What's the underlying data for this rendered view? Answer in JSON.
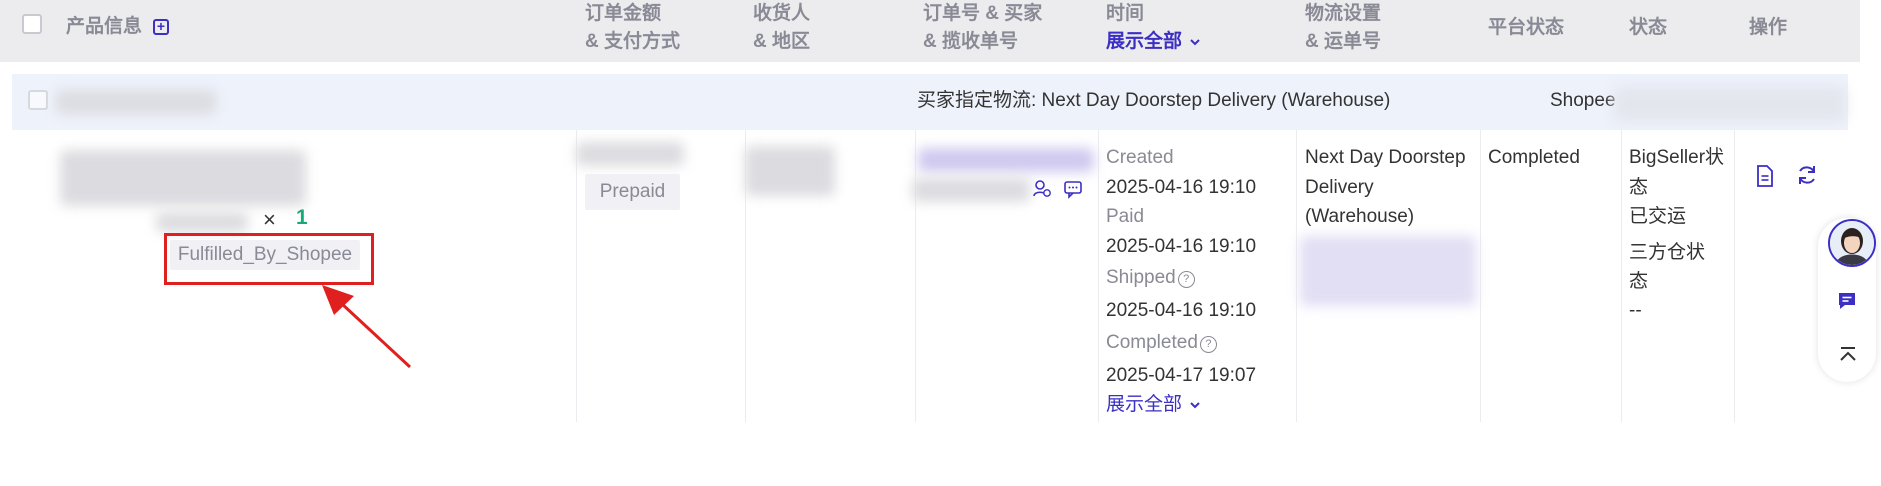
{
  "header": {
    "product_info": "产品信息",
    "amount_line1": "订单金额",
    "amount_line2": "& 支付方式",
    "receiver_line1": "收货人",
    "receiver_line2": "& 地区",
    "orderno_line1": "订单号 & 买家",
    "orderno_line2": "& 揽收单号",
    "time_line1": "时间",
    "time_expand": "展示全部",
    "logistics_line1": "物流设置",
    "logistics_line2": "& 运单号",
    "platform_status": "平台状态",
    "status": "状态",
    "actions": "操作"
  },
  "group_row": {
    "designated_logistics": "买家指定物流: Next Day Doorstep Delivery (Warehouse)",
    "store": "Shopee"
  },
  "order": {
    "qty_sign": "×",
    "qty": "1",
    "fulfillment_tag": "Fulfilled_By_Shopee",
    "payment": "Prepaid",
    "times": {
      "created_label": "Created",
      "created_value": "2025-04-16 19:10",
      "paid_label": "Paid",
      "paid_value": "2025-04-16 19:10",
      "shipped_label": "Shipped",
      "shipped_value": "2025-04-16 19:10",
      "completed_label": "Completed",
      "completed_value": "2025-04-17 19:07",
      "expand": "展示全部"
    },
    "logistics_line1": "Next Day Doorstep",
    "logistics_line2": "Delivery",
    "logistics_line3": "(Warehouse)",
    "platform_status": "Completed",
    "bigseller_status_line1": "BigSeller状",
    "bigseller_status_line2": "态",
    "bigseller_status_value": "已交运",
    "warehouse_status_line1": "三方仓状",
    "warehouse_status_line2": "态",
    "warehouse_status_value": "--"
  },
  "colors": {
    "accent": "#3b2fc4",
    "highlight": "#e0201e",
    "qty": "#1aa87b"
  },
  "icons": [
    "plus-square-icon",
    "chevron-down-icon",
    "buyer-icon",
    "chat-icon",
    "document-icon",
    "refresh-icon",
    "help-icon",
    "message-icon",
    "back-to-top-icon"
  ]
}
